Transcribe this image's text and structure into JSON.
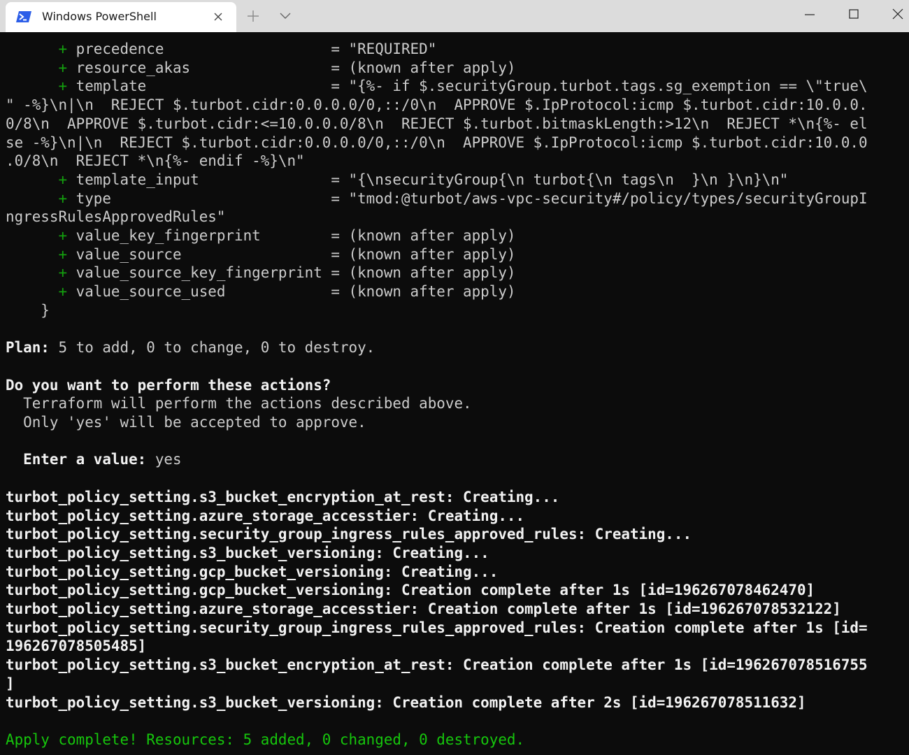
{
  "window": {
    "tab_title": "Windows PowerShell",
    "tab_icon": "powershell-icon",
    "new_tab_icon": "plus-icon",
    "dropdown_icon": "chevron-down-icon",
    "minimize_icon": "minimize-icon",
    "maximize_icon": "maximize-icon",
    "close_icon": "close-icon"
  },
  "colors": {
    "background": "#0c0c0c",
    "text": "#cccccc",
    "plus": "#13a10e",
    "success": "#16c60c",
    "titlebar": "#dcdcdc",
    "tab": "#ffffff"
  },
  "terminal": {
    "lines": [
      {
        "plus": "+",
        "text": " precedence                   = \"REQUIRED\""
      },
      {
        "plus": "+",
        "text": " resource_akas                = (known after apply)"
      },
      {
        "plus": "+",
        "text": " template                     = \"{%- if $.securityGroup.turbot.tags.sg_exemption == \\\"true\\"
      },
      {
        "text": "\" -%}\\n|\\n  REJECT $.turbot.cidr:0.0.0.0/0,::/0\\n  APPROVE $.IpProtocol:icmp $.turbot.cidr:10.0.0."
      },
      {
        "text": "0/8\\n  APPROVE $.turbot.cidr:<=10.0.0.0/8\\n  REJECT $.turbot.bitmaskLength:>12\\n  REJECT *\\n{%- el"
      },
      {
        "text": "se -%}\\n|\\n  REJECT $.turbot.cidr:0.0.0.0/0,::/0\\n  APPROVE $.IpProtocol:icmp $.turbot.cidr:10.0.0"
      },
      {
        "text": ".0/8\\n  REJECT *\\n{%- endif -%}\\n\""
      },
      {
        "plus": "+",
        "text": " template_input               = \"{\\nsecurityGroup{\\n turbot{\\n tags\\n  }\\n }\\n}\\n\""
      },
      {
        "plus": "+",
        "text": " type                         = \"tmod:@turbot/aws-vpc-security#/policy/types/securityGroupI"
      },
      {
        "text": "ngressRulesApprovedRules\""
      },
      {
        "plus": "+",
        "text": " value_key_fingerprint        = (known after apply)"
      },
      {
        "plus": "+",
        "text": " value_source                 = (known after apply)"
      },
      {
        "plus": "+",
        "text": " value_source_key_fingerprint = (known after apply)"
      },
      {
        "plus": "+",
        "text": " value_source_used            = (known after apply)"
      },
      {
        "text": "    }"
      },
      {
        "text": ""
      },
      {
        "bold": "Plan:",
        "text": " 5 to add, 0 to change, 0 to destroy."
      },
      {
        "text": ""
      },
      {
        "bold": "Do you want to perform these actions?"
      },
      {
        "text": "  Terraform will perform the actions described above."
      },
      {
        "text": "  Only 'yes' will be accepted to approve."
      },
      {
        "text": ""
      },
      {
        "bold": "  Enter a value:",
        "text": " yes"
      },
      {
        "text": ""
      },
      {
        "bold": "turbot_policy_setting.s3_bucket_encryption_at_rest: Creating..."
      },
      {
        "bold": "turbot_policy_setting.azure_storage_accesstier: Creating..."
      },
      {
        "bold": "turbot_policy_setting.security_group_ingress_rules_approved_rules: Creating..."
      },
      {
        "bold": "turbot_policy_setting.s3_bucket_versioning: Creating..."
      },
      {
        "bold": "turbot_policy_setting.gcp_bucket_versioning: Creating..."
      },
      {
        "bold": "turbot_policy_setting.gcp_bucket_versioning: Creation complete after 1s [id=196267078462470]"
      },
      {
        "bold": "turbot_policy_setting.azure_storage_accesstier: Creation complete after 1s [id=196267078532122]"
      },
      {
        "bold": "turbot_policy_setting.security_group_ingress_rules_approved_rules: Creation complete after 1s [id="
      },
      {
        "bold": "196267078505485]"
      },
      {
        "bold": "turbot_policy_setting.s3_bucket_encryption_at_rest: Creation complete after 1s [id=196267078516755"
      },
      {
        "bold": "]"
      },
      {
        "bold": "turbot_policy_setting.s3_bucket_versioning: Creation complete after 2s [id=196267078511632]"
      },
      {
        "text": ""
      },
      {
        "green": "Apply complete! Resources: 5 added, 0 changed, 0 destroyed."
      }
    ]
  }
}
